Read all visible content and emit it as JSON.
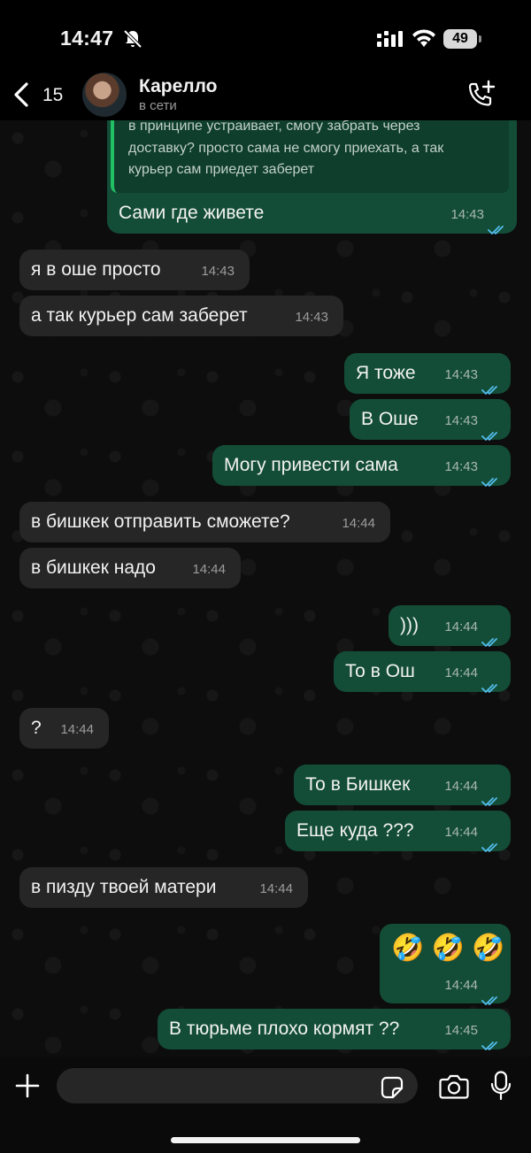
{
  "status_bar": {
    "time": "14:47",
    "battery": "49"
  },
  "header": {
    "back_count": "15",
    "contact_name": "Карелло",
    "contact_status": "в сети"
  },
  "quoted": {
    "lines": [
      "в принципе устраивает, смогу забрать через",
      "доставку? просто сама не смогу приехать, а так",
      "курьер сам приедет заберет"
    ]
  },
  "messages": [
    {
      "dir": "out",
      "text": "Сами где живете",
      "time": "14:43",
      "read": true
    },
    {
      "dir": "in",
      "text": "я в оше просто",
      "time": "14:43"
    },
    {
      "dir": "in",
      "text": "а так курьер сам заберет",
      "time": "14:43"
    },
    {
      "dir": "out",
      "text": "Я тоже",
      "time": "14:43",
      "read": true
    },
    {
      "dir": "out",
      "text": "В Оше",
      "time": "14:43",
      "read": true
    },
    {
      "dir": "out",
      "text": "Могу привести сама",
      "time": "14:43",
      "read": true
    },
    {
      "dir": "in",
      "text": "в бишкек отправить сможете?",
      "time": "14:44"
    },
    {
      "dir": "in",
      "text": "в бишкек надо",
      "time": "14:44"
    },
    {
      "dir": "out",
      "text": ")))",
      "time": "14:44",
      "read": true
    },
    {
      "dir": "out",
      "text": "То в Ош",
      "time": "14:44",
      "read": true
    },
    {
      "dir": "in",
      "text": "?",
      "time": "14:44"
    },
    {
      "dir": "out",
      "text": "То в Бишкек",
      "time": "14:44",
      "read": true
    },
    {
      "dir": "out",
      "text": "Еще куда ???",
      "time": "14:44",
      "read": true
    },
    {
      "dir": "in",
      "text": "в пизду твоей матери",
      "time": "14:44"
    },
    {
      "dir": "out",
      "text": "🤣 🤣 🤣",
      "time": "14:44",
      "read": true
    },
    {
      "dir": "out",
      "text": "В тюрьме плохо кормят ??",
      "time": "14:45",
      "read": true
    }
  ],
  "input": {
    "placeholder": ""
  },
  "colors": {
    "outgoing_bubble": "#134d37",
    "incoming_bubble": "#262626",
    "read_ticks": "#53bdeb",
    "accent": "#21c063"
  },
  "icons": [
    "bell-slash-icon",
    "signal-icon",
    "wifi-icon",
    "battery-icon",
    "back-chevron-icon",
    "call-add-icon",
    "plus-icon",
    "sticker-icon",
    "camera-icon",
    "mic-icon",
    "double-check-icon"
  ]
}
